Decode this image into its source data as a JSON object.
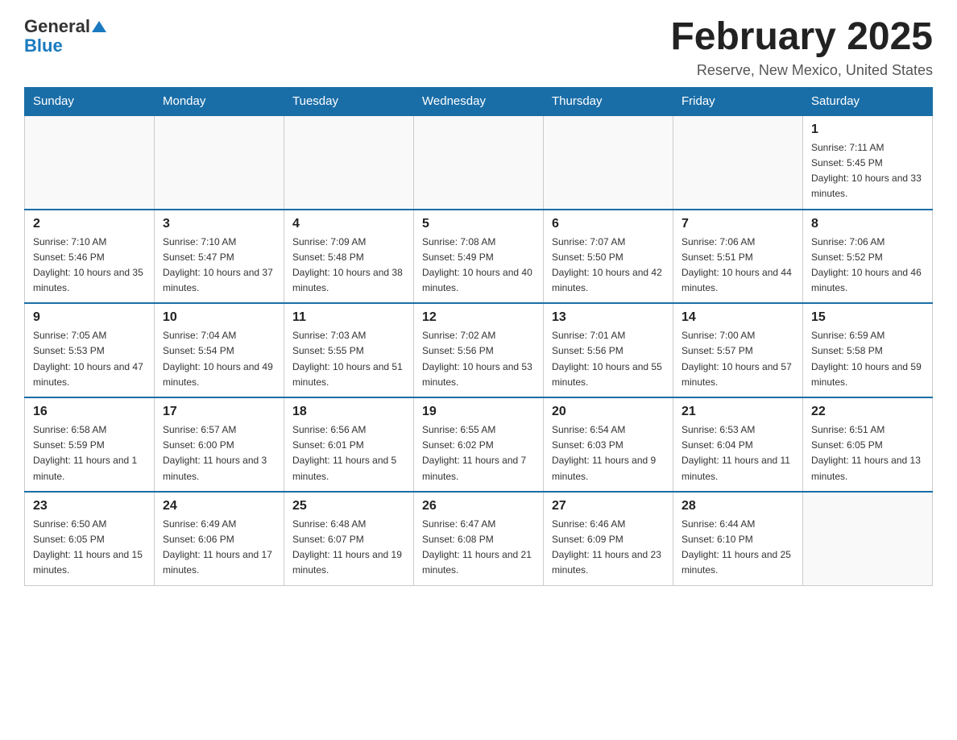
{
  "logo": {
    "general": "General",
    "blue": "Blue"
  },
  "header": {
    "title": "February 2025",
    "location": "Reserve, New Mexico, United States"
  },
  "days_of_week": [
    "Sunday",
    "Monday",
    "Tuesday",
    "Wednesday",
    "Thursday",
    "Friday",
    "Saturday"
  ],
  "weeks": [
    {
      "days": [
        {
          "date": "",
          "empty": true
        },
        {
          "date": "",
          "empty": true
        },
        {
          "date": "",
          "empty": true
        },
        {
          "date": "",
          "empty": true
        },
        {
          "date": "",
          "empty": true
        },
        {
          "date": "",
          "empty": true
        },
        {
          "date": "1",
          "sunrise": "Sunrise: 7:11 AM",
          "sunset": "Sunset: 5:45 PM",
          "daylight": "Daylight: 10 hours and 33 minutes."
        }
      ]
    },
    {
      "days": [
        {
          "date": "2",
          "sunrise": "Sunrise: 7:10 AM",
          "sunset": "Sunset: 5:46 PM",
          "daylight": "Daylight: 10 hours and 35 minutes."
        },
        {
          "date": "3",
          "sunrise": "Sunrise: 7:10 AM",
          "sunset": "Sunset: 5:47 PM",
          "daylight": "Daylight: 10 hours and 37 minutes."
        },
        {
          "date": "4",
          "sunrise": "Sunrise: 7:09 AM",
          "sunset": "Sunset: 5:48 PM",
          "daylight": "Daylight: 10 hours and 38 minutes."
        },
        {
          "date": "5",
          "sunrise": "Sunrise: 7:08 AM",
          "sunset": "Sunset: 5:49 PM",
          "daylight": "Daylight: 10 hours and 40 minutes."
        },
        {
          "date": "6",
          "sunrise": "Sunrise: 7:07 AM",
          "sunset": "Sunset: 5:50 PM",
          "daylight": "Daylight: 10 hours and 42 minutes."
        },
        {
          "date": "7",
          "sunrise": "Sunrise: 7:06 AM",
          "sunset": "Sunset: 5:51 PM",
          "daylight": "Daylight: 10 hours and 44 minutes."
        },
        {
          "date": "8",
          "sunrise": "Sunrise: 7:06 AM",
          "sunset": "Sunset: 5:52 PM",
          "daylight": "Daylight: 10 hours and 46 minutes."
        }
      ]
    },
    {
      "days": [
        {
          "date": "9",
          "sunrise": "Sunrise: 7:05 AM",
          "sunset": "Sunset: 5:53 PM",
          "daylight": "Daylight: 10 hours and 47 minutes."
        },
        {
          "date": "10",
          "sunrise": "Sunrise: 7:04 AM",
          "sunset": "Sunset: 5:54 PM",
          "daylight": "Daylight: 10 hours and 49 minutes."
        },
        {
          "date": "11",
          "sunrise": "Sunrise: 7:03 AM",
          "sunset": "Sunset: 5:55 PM",
          "daylight": "Daylight: 10 hours and 51 minutes."
        },
        {
          "date": "12",
          "sunrise": "Sunrise: 7:02 AM",
          "sunset": "Sunset: 5:56 PM",
          "daylight": "Daylight: 10 hours and 53 minutes."
        },
        {
          "date": "13",
          "sunrise": "Sunrise: 7:01 AM",
          "sunset": "Sunset: 5:56 PM",
          "daylight": "Daylight: 10 hours and 55 minutes."
        },
        {
          "date": "14",
          "sunrise": "Sunrise: 7:00 AM",
          "sunset": "Sunset: 5:57 PM",
          "daylight": "Daylight: 10 hours and 57 minutes."
        },
        {
          "date": "15",
          "sunrise": "Sunrise: 6:59 AM",
          "sunset": "Sunset: 5:58 PM",
          "daylight": "Daylight: 10 hours and 59 minutes."
        }
      ]
    },
    {
      "days": [
        {
          "date": "16",
          "sunrise": "Sunrise: 6:58 AM",
          "sunset": "Sunset: 5:59 PM",
          "daylight": "Daylight: 11 hours and 1 minute."
        },
        {
          "date": "17",
          "sunrise": "Sunrise: 6:57 AM",
          "sunset": "Sunset: 6:00 PM",
          "daylight": "Daylight: 11 hours and 3 minutes."
        },
        {
          "date": "18",
          "sunrise": "Sunrise: 6:56 AM",
          "sunset": "Sunset: 6:01 PM",
          "daylight": "Daylight: 11 hours and 5 minutes."
        },
        {
          "date": "19",
          "sunrise": "Sunrise: 6:55 AM",
          "sunset": "Sunset: 6:02 PM",
          "daylight": "Daylight: 11 hours and 7 minutes."
        },
        {
          "date": "20",
          "sunrise": "Sunrise: 6:54 AM",
          "sunset": "Sunset: 6:03 PM",
          "daylight": "Daylight: 11 hours and 9 minutes."
        },
        {
          "date": "21",
          "sunrise": "Sunrise: 6:53 AM",
          "sunset": "Sunset: 6:04 PM",
          "daylight": "Daylight: 11 hours and 11 minutes."
        },
        {
          "date": "22",
          "sunrise": "Sunrise: 6:51 AM",
          "sunset": "Sunset: 6:05 PM",
          "daylight": "Daylight: 11 hours and 13 minutes."
        }
      ]
    },
    {
      "days": [
        {
          "date": "23",
          "sunrise": "Sunrise: 6:50 AM",
          "sunset": "Sunset: 6:05 PM",
          "daylight": "Daylight: 11 hours and 15 minutes."
        },
        {
          "date": "24",
          "sunrise": "Sunrise: 6:49 AM",
          "sunset": "Sunset: 6:06 PM",
          "daylight": "Daylight: 11 hours and 17 minutes."
        },
        {
          "date": "25",
          "sunrise": "Sunrise: 6:48 AM",
          "sunset": "Sunset: 6:07 PM",
          "daylight": "Daylight: 11 hours and 19 minutes."
        },
        {
          "date": "26",
          "sunrise": "Sunrise: 6:47 AM",
          "sunset": "Sunset: 6:08 PM",
          "daylight": "Daylight: 11 hours and 21 minutes."
        },
        {
          "date": "27",
          "sunrise": "Sunrise: 6:46 AM",
          "sunset": "Sunset: 6:09 PM",
          "daylight": "Daylight: 11 hours and 23 minutes."
        },
        {
          "date": "28",
          "sunrise": "Sunrise: 6:44 AM",
          "sunset": "Sunset: 6:10 PM",
          "daylight": "Daylight: 11 hours and 25 minutes."
        },
        {
          "date": "",
          "empty": true
        }
      ]
    }
  ]
}
